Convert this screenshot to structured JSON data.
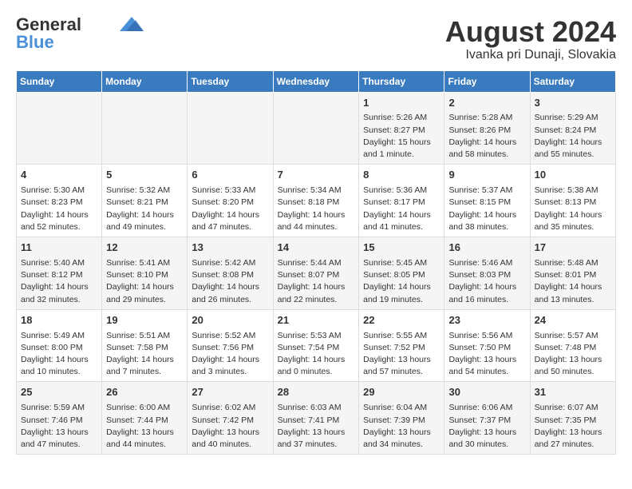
{
  "logo": {
    "line1": "General",
    "line2": "Blue"
  },
  "title": "August 2024",
  "subtitle": "Ivanka pri Dunaji, Slovakia",
  "days_of_week": [
    "Sunday",
    "Monday",
    "Tuesday",
    "Wednesday",
    "Thursday",
    "Friday",
    "Saturday"
  ],
  "weeks": [
    [
      {
        "day": "",
        "info": ""
      },
      {
        "day": "",
        "info": ""
      },
      {
        "day": "",
        "info": ""
      },
      {
        "day": "",
        "info": ""
      },
      {
        "day": "1",
        "info": "Sunrise: 5:26 AM\nSunset: 8:27 PM\nDaylight: 15 hours and 1 minute."
      },
      {
        "day": "2",
        "info": "Sunrise: 5:28 AM\nSunset: 8:26 PM\nDaylight: 14 hours and 58 minutes."
      },
      {
        "day": "3",
        "info": "Sunrise: 5:29 AM\nSunset: 8:24 PM\nDaylight: 14 hours and 55 minutes."
      }
    ],
    [
      {
        "day": "4",
        "info": "Sunrise: 5:30 AM\nSunset: 8:23 PM\nDaylight: 14 hours and 52 minutes."
      },
      {
        "day": "5",
        "info": "Sunrise: 5:32 AM\nSunset: 8:21 PM\nDaylight: 14 hours and 49 minutes."
      },
      {
        "day": "6",
        "info": "Sunrise: 5:33 AM\nSunset: 8:20 PM\nDaylight: 14 hours and 47 minutes."
      },
      {
        "day": "7",
        "info": "Sunrise: 5:34 AM\nSunset: 8:18 PM\nDaylight: 14 hours and 44 minutes."
      },
      {
        "day": "8",
        "info": "Sunrise: 5:36 AM\nSunset: 8:17 PM\nDaylight: 14 hours and 41 minutes."
      },
      {
        "day": "9",
        "info": "Sunrise: 5:37 AM\nSunset: 8:15 PM\nDaylight: 14 hours and 38 minutes."
      },
      {
        "day": "10",
        "info": "Sunrise: 5:38 AM\nSunset: 8:13 PM\nDaylight: 14 hours and 35 minutes."
      }
    ],
    [
      {
        "day": "11",
        "info": "Sunrise: 5:40 AM\nSunset: 8:12 PM\nDaylight: 14 hours and 32 minutes."
      },
      {
        "day": "12",
        "info": "Sunrise: 5:41 AM\nSunset: 8:10 PM\nDaylight: 14 hours and 29 minutes."
      },
      {
        "day": "13",
        "info": "Sunrise: 5:42 AM\nSunset: 8:08 PM\nDaylight: 14 hours and 26 minutes."
      },
      {
        "day": "14",
        "info": "Sunrise: 5:44 AM\nSunset: 8:07 PM\nDaylight: 14 hours and 22 minutes."
      },
      {
        "day": "15",
        "info": "Sunrise: 5:45 AM\nSunset: 8:05 PM\nDaylight: 14 hours and 19 minutes."
      },
      {
        "day": "16",
        "info": "Sunrise: 5:46 AM\nSunset: 8:03 PM\nDaylight: 14 hours and 16 minutes."
      },
      {
        "day": "17",
        "info": "Sunrise: 5:48 AM\nSunset: 8:01 PM\nDaylight: 14 hours and 13 minutes."
      }
    ],
    [
      {
        "day": "18",
        "info": "Sunrise: 5:49 AM\nSunset: 8:00 PM\nDaylight: 14 hours and 10 minutes."
      },
      {
        "day": "19",
        "info": "Sunrise: 5:51 AM\nSunset: 7:58 PM\nDaylight: 14 hours and 7 minutes."
      },
      {
        "day": "20",
        "info": "Sunrise: 5:52 AM\nSunset: 7:56 PM\nDaylight: 14 hours and 3 minutes."
      },
      {
        "day": "21",
        "info": "Sunrise: 5:53 AM\nSunset: 7:54 PM\nDaylight: 14 hours and 0 minutes."
      },
      {
        "day": "22",
        "info": "Sunrise: 5:55 AM\nSunset: 7:52 PM\nDaylight: 13 hours and 57 minutes."
      },
      {
        "day": "23",
        "info": "Sunrise: 5:56 AM\nSunset: 7:50 PM\nDaylight: 13 hours and 54 minutes."
      },
      {
        "day": "24",
        "info": "Sunrise: 5:57 AM\nSunset: 7:48 PM\nDaylight: 13 hours and 50 minutes."
      }
    ],
    [
      {
        "day": "25",
        "info": "Sunrise: 5:59 AM\nSunset: 7:46 PM\nDaylight: 13 hours and 47 minutes."
      },
      {
        "day": "26",
        "info": "Sunrise: 6:00 AM\nSunset: 7:44 PM\nDaylight: 13 hours and 44 minutes."
      },
      {
        "day": "27",
        "info": "Sunrise: 6:02 AM\nSunset: 7:42 PM\nDaylight: 13 hours and 40 minutes."
      },
      {
        "day": "28",
        "info": "Sunrise: 6:03 AM\nSunset: 7:41 PM\nDaylight: 13 hours and 37 minutes."
      },
      {
        "day": "29",
        "info": "Sunrise: 6:04 AM\nSunset: 7:39 PM\nDaylight: 13 hours and 34 minutes."
      },
      {
        "day": "30",
        "info": "Sunrise: 6:06 AM\nSunset: 7:37 PM\nDaylight: 13 hours and 30 minutes."
      },
      {
        "day": "31",
        "info": "Sunrise: 6:07 AM\nSunset: 7:35 PM\nDaylight: 13 hours and 27 minutes."
      }
    ]
  ]
}
